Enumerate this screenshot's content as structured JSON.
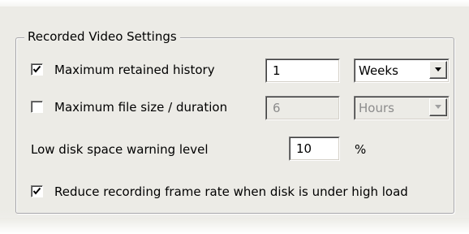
{
  "group": {
    "title": "Recorded Video Settings"
  },
  "retained_history": {
    "label": "Maximum retained history",
    "checked": true,
    "value": "1",
    "unit": "Weeks",
    "enabled": true
  },
  "file_size": {
    "label": "Maximum file size / duration",
    "checked": false,
    "value": "6",
    "unit": "Hours",
    "enabled": false
  },
  "low_disk": {
    "label": "Low disk space warning level",
    "value": "10",
    "unit": "%"
  },
  "reduce_frame_rate": {
    "label": "Reduce recording frame rate when disk is under high load",
    "checked": true
  },
  "icons": {
    "check": "checkmark-icon",
    "dropdown": "chevron-down-icon"
  },
  "colors": {
    "panel_background": "#ecebe6",
    "disabled_text": "#8c8c8c",
    "group_border": "#a7a6aa"
  }
}
